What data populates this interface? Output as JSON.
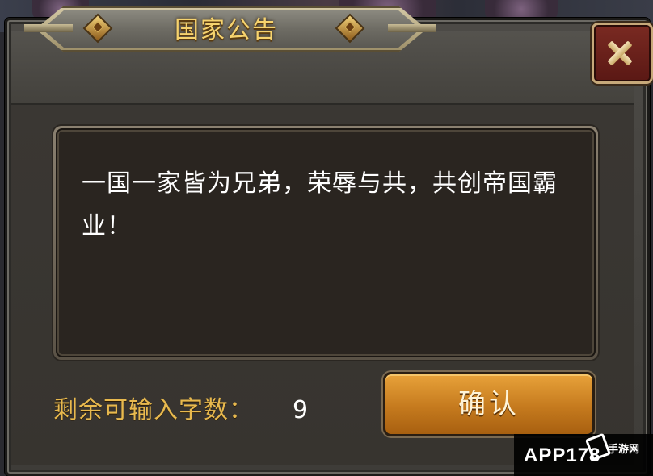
{
  "dialog": {
    "title": "国家公告",
    "close_icon": "close-x-icon"
  },
  "announcement": {
    "text": "一国一家皆为兄弟，荣辱与共，共创帝国霸业！"
  },
  "char_counter": {
    "label": "剩余可输入字数：",
    "value": "9"
  },
  "confirm_button": {
    "label": "确认"
  },
  "watermark": {
    "text": "APP178",
    "sub_text": "手游网"
  },
  "colors": {
    "title": "#f6d36e",
    "counter_label": "#e8b94e",
    "confirm_button": "#c57a1e",
    "close_button": "#7a2a22"
  }
}
